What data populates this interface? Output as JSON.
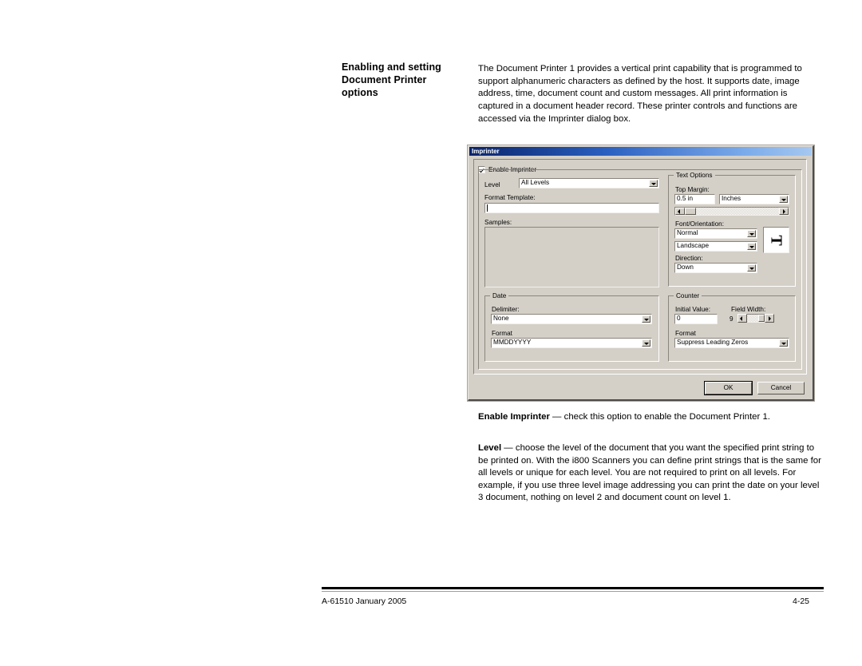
{
  "page": {
    "heading": "Enabling and setting Document Printer options",
    "intro": "The Document Printer 1 provides a vertical print capability that is programmed to support alphanumeric characters as defined by the host. It supports date, image address, time, document count and custom messages. All print information is captured in a document header record. These printer controls and functions are accessed via the Imprinter dialog box.",
    "sections": [
      {
        "term": "Enable Imprinter",
        "dash": " — ",
        "text": "check this option to enable the Document Printer 1."
      },
      {
        "term": "Level",
        "dash": " — ",
        "text": "choose the level of the document that you want the specified print string to be printed on. With the i800 Scanners you can define print strings that is the same for all levels or unique for each level. You are not required to print on all levels. For example, if you use three level image addressing you can print the date on your level 3 document, nothing on level 2 and document count on level 1."
      }
    ],
    "footer": {
      "left": "A-61510 January 2005",
      "right": "4-25"
    }
  },
  "dialog": {
    "title": "Imprinter",
    "title_bar_color_start": "#0a246a",
    "title_bar_color_end": "#a6c8f0",
    "face_color": "#d4d0c8",
    "enable_checkbox": {
      "label": "Enable Imprinter",
      "checked": true
    },
    "level": {
      "label": "Level",
      "value": "All Levels"
    },
    "format_template": {
      "label": "Format Template:",
      "value": ""
    },
    "samples": {
      "label": "Samples:",
      "value": ""
    },
    "text_options": {
      "title": "Text Options",
      "top_margin": {
        "label": "Top Margin:",
        "value": "0.5 in",
        "units": "Inches"
      },
      "font_orientation": {
        "label": "Font/Orientation:",
        "font": "Normal",
        "orientation": "Landscape",
        "preview_glyph": "T"
      },
      "direction": {
        "label": "Direction:",
        "value": "Down"
      }
    },
    "date": {
      "title": "Date",
      "delimiter": {
        "label": "Delimiter:",
        "value": "None"
      },
      "format": {
        "label": "Format",
        "value": "MMDDYYYY"
      }
    },
    "counter": {
      "title": "Counter",
      "initial_value": {
        "label": "Initial Value:",
        "value": "0"
      },
      "field_width": {
        "label": "Field Width:",
        "value": "9"
      },
      "format": {
        "label": "Format",
        "value": "Suppress Leading Zeros"
      }
    },
    "buttons": {
      "ok": "OK",
      "cancel": "Cancel"
    }
  }
}
